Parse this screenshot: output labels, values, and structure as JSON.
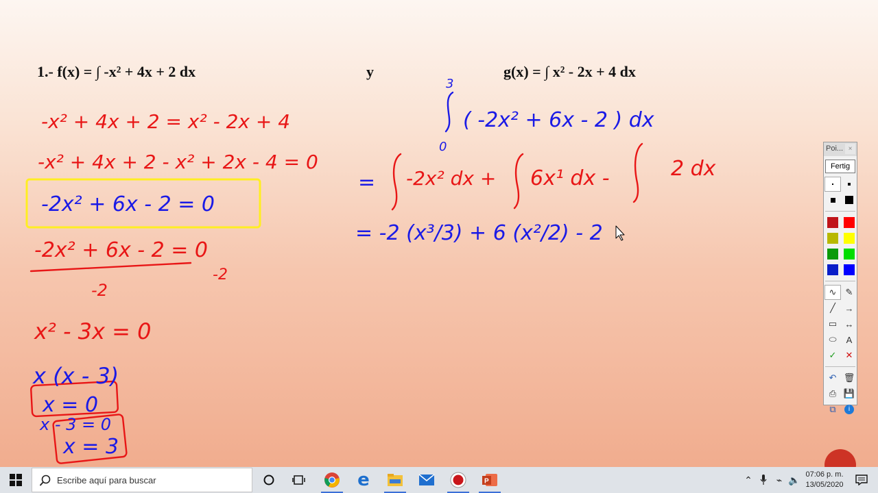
{
  "slide": {
    "problem_number": "1.- ",
    "f_def": "f(x) = ∫  -x² + 4x + 2 dx",
    "conjunction": "y",
    "g_def": "g(x) = ∫  x² - 2x + 4 dx"
  },
  "ink": {
    "line1": "-x² + 4x + 2 = x² - 2x + 4",
    "line2": "-x² + 4x + 2 - x² + 2x - 4 = 0",
    "boxed": "-2x² + 6x - 2 = 0",
    "line4": "-2x² + 6x - 2 = 0",
    "divisor": "-2",
    "divisor2": "-2",
    "line5": "x² - 3x = 0",
    "factored": "x (x - 3)",
    "root1": "x = 0",
    "root2_pre": "x - 3 = 0",
    "root2": "x = 3",
    "integral_upper": "3",
    "integral_lower": "0",
    "integral_body": "( -2x² + 6x - 2 ) dx",
    "step1_eq": "=",
    "step1_a": "-2x² dx +",
    "step1_b": "6x¹ dx -",
    "step1_c": "2 dx",
    "step2": "= -2 (x³/3) + 6 (x²/2) - 2"
  },
  "pen_toolbar": {
    "title": "Poi...",
    "close": "×",
    "done_button": "Fertig",
    "colors": [
      "#c0141a",
      "#ff0000",
      "#b8b800",
      "#ffff00",
      "#0a9a0a",
      "#00dd00",
      "#0a1ec8",
      "#0000ff"
    ],
    "tools": [
      "pen-tool",
      "eraser-tool",
      "line-tool",
      "arrow-tool",
      "rectangle-tool",
      "double-arrow-tool",
      "ellipse-tool",
      "text-tool",
      "check-tool",
      "cross-tool",
      "undo-tool",
      "trash-tool",
      "print-tool",
      "save-tool",
      "copy-tool",
      "info-tool"
    ],
    "text_tool_label": "A"
  },
  "taskbar": {
    "search_placeholder": "Escribe aquí para buscar",
    "apps": [
      "cortana-icon",
      "task-view-icon",
      "chrome-icon",
      "edge-icon",
      "file-explorer-icon",
      "mail-icon",
      "record-icon",
      "powerpoint-icon"
    ],
    "time": "07:06 p. m.",
    "date": "13/05/2020"
  }
}
